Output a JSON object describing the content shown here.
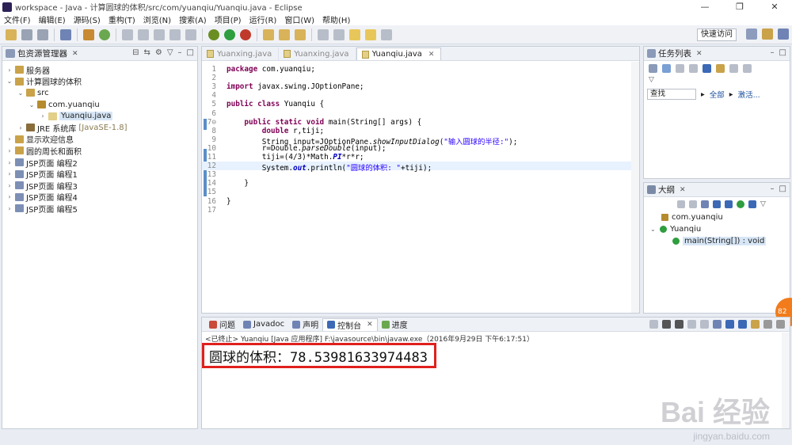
{
  "window": {
    "title": "workspace - Java - 计算圆球的体积/src/com/yuanqiu/Yuanqiu.java - Eclipse",
    "minimize": "—",
    "restore": "❐",
    "close": "✕"
  },
  "menu": [
    "文件(F)",
    "编辑(E)",
    "源码(S)",
    "重构(T)",
    "浏览(N)",
    "搜索(A)",
    "项目(P)",
    "运行(R)",
    "窗口(W)",
    "帮助(H)"
  ],
  "toolbar": {
    "quick_access": "快速访问"
  },
  "package_explorer": {
    "title": "包资源管理器",
    "tab_suffix": "✕",
    "items": [
      {
        "label": "服务器",
        "indent": 0,
        "arrow": "›",
        "icon_color": "#c9a24a"
      },
      {
        "label": "计算圆球的体积",
        "indent": 0,
        "arrow": "⌄",
        "icon_color": "#c9a24a"
      },
      {
        "label": "src",
        "indent": 1,
        "arrow": "⌄",
        "icon_color": "#c9a24a"
      },
      {
        "label": "com.yuanqiu",
        "indent": 2,
        "arrow": "⌄",
        "icon_color": "#b68b2e"
      },
      {
        "label": "Yuanqiu.java",
        "indent": 3,
        "arrow": "›",
        "icon_color": "#e2cf88",
        "selected": true
      },
      {
        "label": "JRE 系统库",
        "extra": "[JavaSE-1.8]",
        "indent": 1,
        "arrow": "›",
        "icon_color": "#8a6d3b"
      },
      {
        "label": "显示欢迎信息",
        "indent": 0,
        "arrow": "›",
        "icon_color": "#c9a24a"
      },
      {
        "label": "圆的周长和面积",
        "indent": 0,
        "arrow": "›",
        "icon_color": "#c9a24a"
      },
      {
        "label": "JSP页面 编程2",
        "indent": 0,
        "arrow": "›",
        "icon_color": "#7d8fb5"
      },
      {
        "label": "JSP页面 编程1",
        "indent": 0,
        "arrow": "›",
        "icon_color": "#7d8fb5"
      },
      {
        "label": "JSP页面 编程3",
        "indent": 0,
        "arrow": "›",
        "icon_color": "#7d8fb5"
      },
      {
        "label": "JSP页面 编程4",
        "indent": 0,
        "arrow": "›",
        "icon_color": "#7d8fb5"
      },
      {
        "label": "JSP页面 编程5",
        "indent": 0,
        "arrow": "›",
        "icon_color": "#7d8fb5"
      }
    ]
  },
  "editor": {
    "tabs": [
      {
        "label": "Yuanxing.java",
        "active": false
      },
      {
        "label": "Yuanxing.java",
        "active": false
      },
      {
        "label": "Yuanqiu.java",
        "active": true
      }
    ],
    "tab_close": "✕",
    "current_line": 12,
    "lines": [
      {
        "n": "1",
        "html": "<span class='kw'>package</span> com.yuanqiu;"
      },
      {
        "n": "2",
        "html": ""
      },
      {
        "n": "3",
        "html": "<span class='kw'>import</span> javax.swing.JOptionPane;"
      },
      {
        "n": "4",
        "html": ""
      },
      {
        "n": "5",
        "html": "<span class='kw'>public class</span> Yuanqiu {"
      },
      {
        "n": "6",
        "html": ""
      },
      {
        "n": "7⊖",
        "html": "    <span class='kw'>public static void</span> main(String[] args) {"
      },
      {
        "n": "8",
        "html": "        <span class='kw'>double</span> r,tiji;"
      },
      {
        "n": "9",
        "html": "        String input=JOptionPane.<span class='stat'>showInputDialog</span>(<span class='str'>\"输入圆球的半径:\"</span>);"
      },
      {
        "n": "10",
        "html": "        r=Double.<span class='stat'>parseDouble</span>(input);"
      },
      {
        "n": "11",
        "html": "        tiji=(4/3)*Math.<span class='fld'>PI</span>*r*r;"
      },
      {
        "n": "12",
        "html": "        System.<span class='fld'>out</span>.println(<span class='str'>\"圆球的体积: \"</span>+tiji);"
      },
      {
        "n": "13",
        "html": ""
      },
      {
        "n": "14",
        "html": "    }"
      },
      {
        "n": "15",
        "html": ""
      },
      {
        "n": "16",
        "html": "}"
      },
      {
        "n": "17",
        "html": ""
      }
    ]
  },
  "tasks": {
    "title": "任务列表",
    "find_label": "查找",
    "all_label": "全部",
    "activate_label": "激活..."
  },
  "outline": {
    "title": "大纲",
    "items": [
      {
        "label": "com.yuanqiu",
        "indent": 1
      },
      {
        "label": "Yuanqiu",
        "indent": 0
      },
      {
        "label": "main(String[]) : void",
        "indent": 2,
        "selected": true
      }
    ]
  },
  "bottom": {
    "tabs": [
      "问题",
      "Javadoc",
      "声明",
      "控制台",
      "进度"
    ],
    "active_tab": "控制台",
    "status": "<已终止> Yuanqiu [Java 应用程序] F:\\javasource\\bin\\javaw.exe（2016年9月29日 下午6:17:51）",
    "output": "圆球的体积：78.53981633974483"
  },
  "watermark": {
    "brand": "Bai 经验",
    "url": "jingyan.baidu.com"
  },
  "side_badge": "82"
}
